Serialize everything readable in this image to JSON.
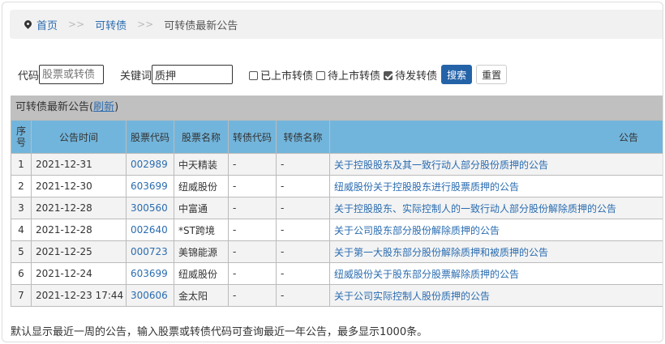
{
  "breadcrumb": {
    "home": "首页",
    "sep": ">>",
    "level2": "可转债",
    "current": "可转债最新公告"
  },
  "form": {
    "code_label": "代码",
    "code_placeholder": "股票或转债",
    "code_value": "",
    "keyword_label": "关键词",
    "keyword_value": "质押",
    "checkboxes": [
      {
        "label": "已上市转债",
        "checked": false
      },
      {
        "label": "待上市转债",
        "checked": false
      },
      {
        "label": "待发转债",
        "checked": true
      }
    ],
    "search_label": "搜索",
    "reset_label": "重置"
  },
  "table": {
    "title": "可转债最新公告",
    "refresh_label": "刷新",
    "headers": [
      "序号",
      "公告时间",
      "股票代码",
      "股票名称",
      "转债代码",
      "转债名称",
      "公告"
    ],
    "rows": [
      [
        "1",
        "2021-12-31",
        "002989",
        "中天精装",
        "-",
        "-",
        "关于控股股东及其一致行动人部分股份质押的公告"
      ],
      [
        "2",
        "2021-12-30",
        "603699",
        "纽威股份",
        "-",
        "-",
        "纽威股份关于控股股东进行股票质押的公告"
      ],
      [
        "3",
        "2021-12-28",
        "300560",
        "中富通",
        "-",
        "-",
        "关于控股股东、实际控制人的一致行动人部分股份解除质押的公告"
      ],
      [
        "4",
        "2021-12-28",
        "002640",
        "*ST跨境",
        "-",
        "-",
        "关于公司股东部分股份解除质押的公告"
      ],
      [
        "5",
        "2021-12-25",
        "000723",
        "美锦能源",
        "-",
        "-",
        "关于第一大股东部分股份解除质押和被质押的公告"
      ],
      [
        "6",
        "2021-12-24",
        "603699",
        "纽威股份",
        "-",
        "-",
        "纽威股份关于股东部分股票解除质押的公告"
      ],
      [
        "7",
        "2021-12-23 17:44",
        "300606",
        "金太阳",
        "-",
        "-",
        "关于公司实际控制人股份质押的公告"
      ]
    ]
  },
  "footer_note": "默认显示最近一周的公告，输入股票或转债代码可查询最近一年公告，最多显示1000条。",
  "colors": {
    "link": "#2a6cb0",
    "header_bg": "#72b5dc",
    "search_btn": "#2563a8"
  }
}
